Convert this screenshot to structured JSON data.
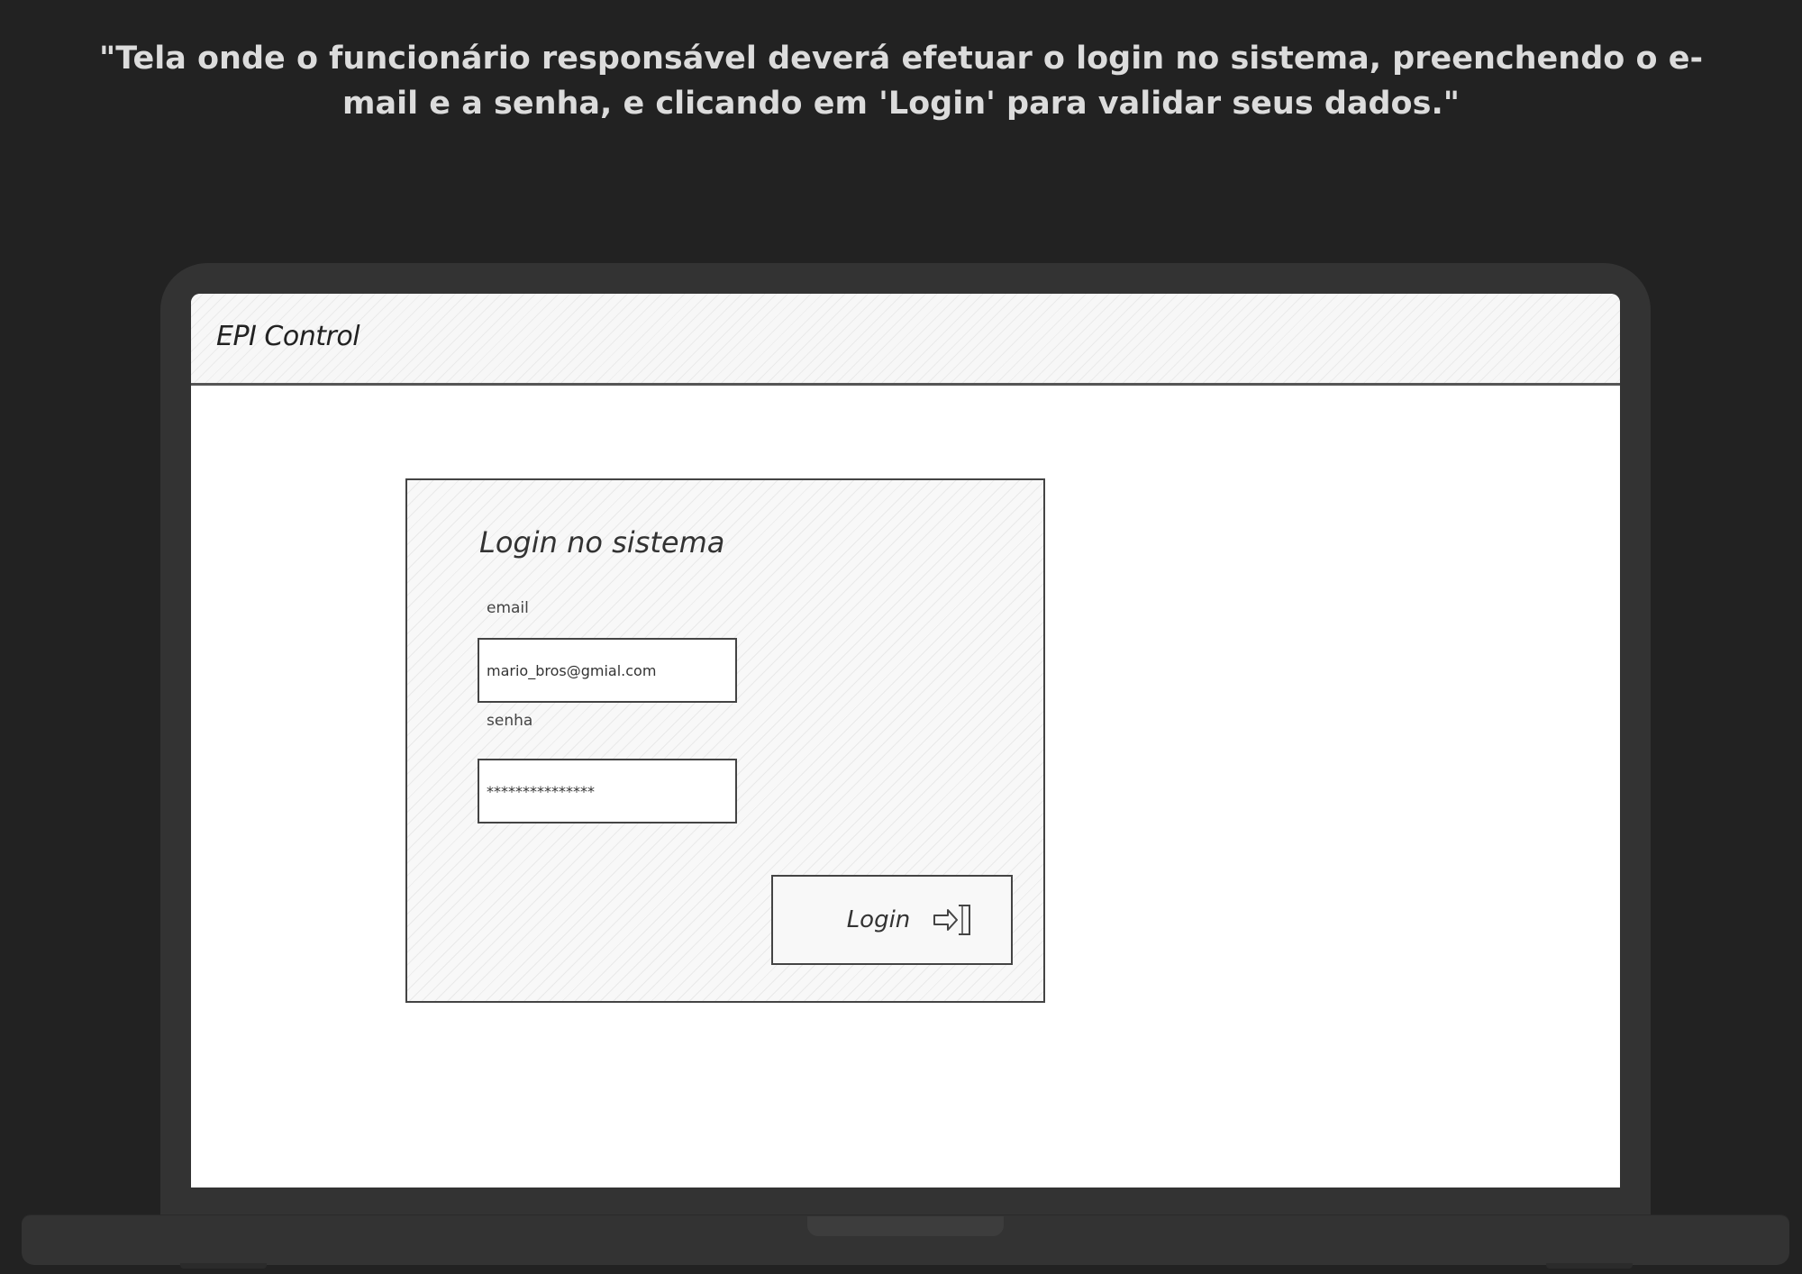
{
  "caption": "\"Tela onde o funcionário responsável deverá efetuar o login no sistema, preenchendo o e-mail e a senha, e clicando em 'Login' para validar seus dados.\"",
  "app": {
    "title": "EPI Control"
  },
  "login_form": {
    "title": "Login no sistema",
    "email_label": "email",
    "email_value": "mario_bros@gmial.com",
    "senha_label": "senha",
    "senha_value": "***************",
    "login_button_label": "Login",
    "login_icon": "sign-in-icon"
  },
  "colors": {
    "background": "#222222",
    "device": "#333333",
    "screen": "#ffffff",
    "sketch_line": "#444444"
  }
}
